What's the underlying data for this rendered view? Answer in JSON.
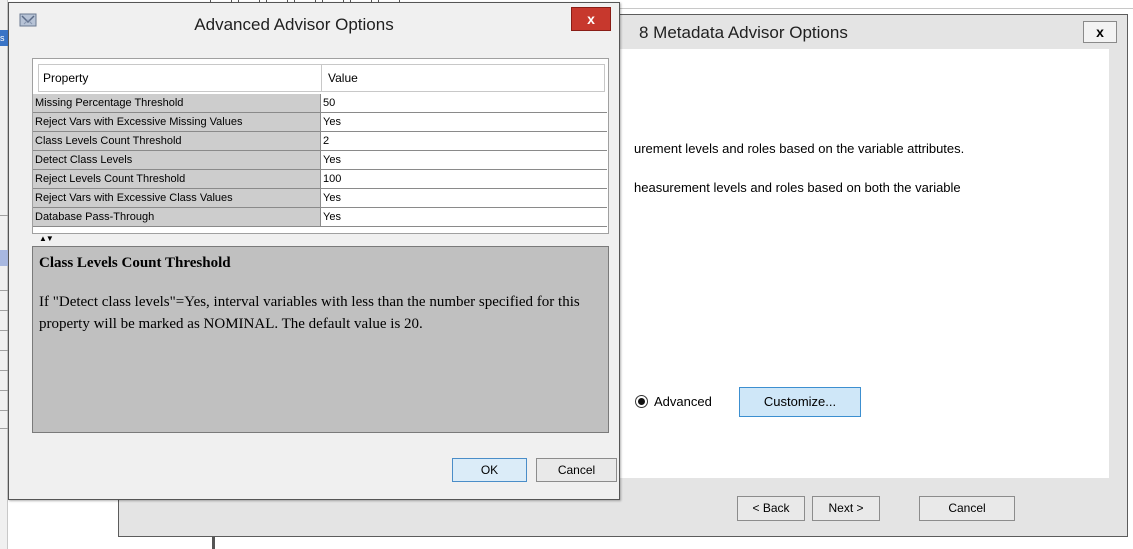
{
  "background": {
    "left_badge_text": "s"
  },
  "meta_window": {
    "title": "8  Metadata Advisor Options",
    "close_label": "x",
    "text_line_1": "urement levels and roles based on the variable attributes.",
    "text_line_2": "heasurement levels and roles based on both the variable",
    "radio_label": "Advanced",
    "radio_selected": true,
    "customize_label": "Customize...",
    "back_label": "< Back",
    "next_label": "Next >",
    "cancel_label": "Cancel"
  },
  "adv_dialog": {
    "title": "Advanced Advisor Options",
    "icon": "app-icon",
    "close_label": "x",
    "table": {
      "headers": [
        "Property",
        "Value"
      ],
      "rows": [
        {
          "property": "Missing Percentage Threshold",
          "value": "50"
        },
        {
          "property": "Reject Vars with Excessive Missing Values",
          "value": "Yes"
        },
        {
          "property": "Class Levels Count Threshold",
          "value": "2"
        },
        {
          "property": "Detect Class Levels",
          "value": "Yes"
        },
        {
          "property": "Reject Levels Count Threshold",
          "value": "100"
        },
        {
          "property": "Reject Vars with Excessive Class Values",
          "value": "Yes"
        },
        {
          "property": "Database Pass-Through",
          "value": "Yes"
        }
      ]
    },
    "arrows": "▲▼",
    "description": {
      "title": "Class Levels Count Threshold",
      "text": "If \"Detect class levels\"=Yes, interval variables with less than the number specified for this property will be marked as NOMINAL. The default value is 20."
    },
    "ok_label": "OK",
    "cancel_label": "Cancel"
  },
  "colors": {
    "close_red": "#c7382d",
    "customize_blue": "#cfe7f8",
    "row_label_gray": "#cdcdcd",
    "description_gray": "#c0c0c0"
  }
}
